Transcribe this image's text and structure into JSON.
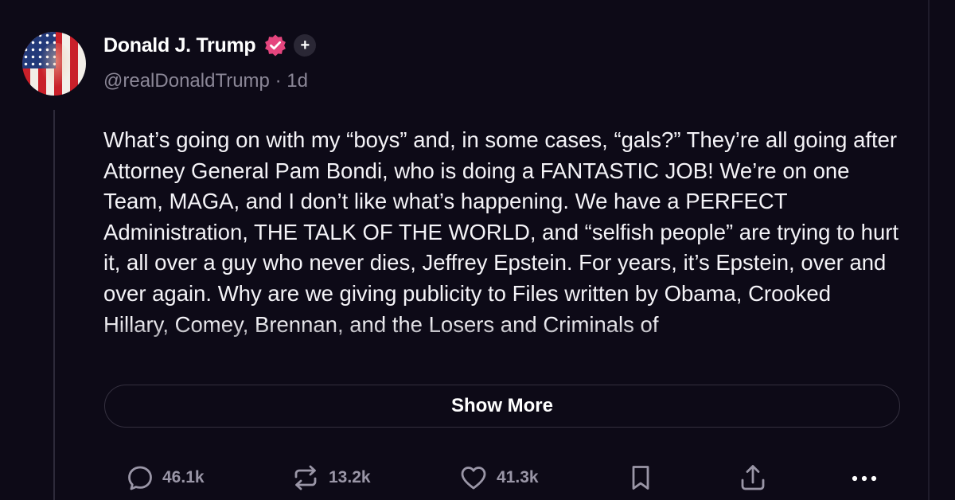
{
  "author": {
    "name": "Donald J. Trump",
    "handle": "@realDonaldTrump",
    "separator": "·",
    "time": "1d"
  },
  "post": {
    "text": "What’s going on with my “boys” and, in some cases, “gals?” They’re all going after Attorney General Pam Bondi, who is doing a FANTASTIC JOB! We’re on one Team, MAGA, and I don’t like what’s happening. We have a PERFECT Administration, THE TALK OF THE WORLD, and “selfish people” are trying to hurt it, all over a guy who never dies, Jeffrey Epstein. For years, it’s Epstein, over and over again. Why are we giving publicity to Files written by Obama, Crooked Hillary, Comey, Brennan, and the Losers and Criminals of"
  },
  "show_more_label": "Show More",
  "actions": {
    "replies": "46.1k",
    "reposts": "13.2k",
    "likes": "41.3k"
  },
  "icons": [
    "avatar",
    "verified-badge-icon",
    "plus-icon",
    "reply-icon",
    "repost-icon",
    "like-icon",
    "bookmark-icon",
    "share-icon",
    "more-icon"
  ],
  "colors": {
    "background": "#0d0a17",
    "verified_badge": "#e5457e",
    "muted_text": "#8b8797",
    "icon_gray": "#9a96a7"
  }
}
